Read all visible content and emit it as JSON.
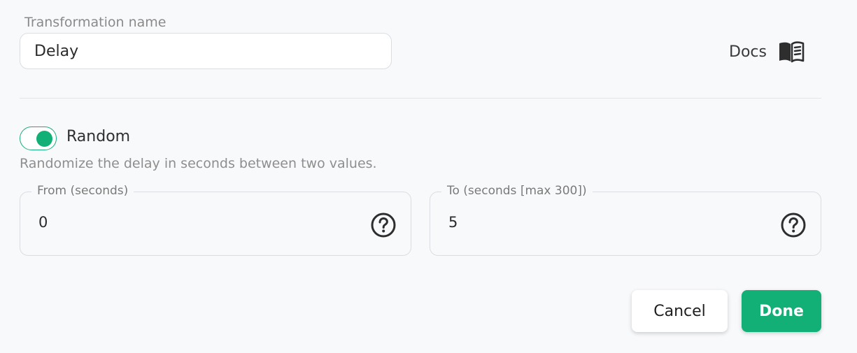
{
  "transformation": {
    "name_label": "Transformation name",
    "name_value": "Delay"
  },
  "docs": {
    "label": "Docs",
    "icon": "book-icon"
  },
  "random": {
    "label": "Random",
    "enabled": true,
    "description": "Randomize the delay in seconds between two values.",
    "accent_color": "#12b076"
  },
  "from_field": {
    "label": "From (seconds)",
    "value": "0",
    "icon": "help-icon"
  },
  "to_field": {
    "label": "To (seconds [max 300])",
    "value": "5",
    "icon": "help-icon"
  },
  "actions": {
    "cancel_label": "Cancel",
    "done_label": "Done"
  }
}
